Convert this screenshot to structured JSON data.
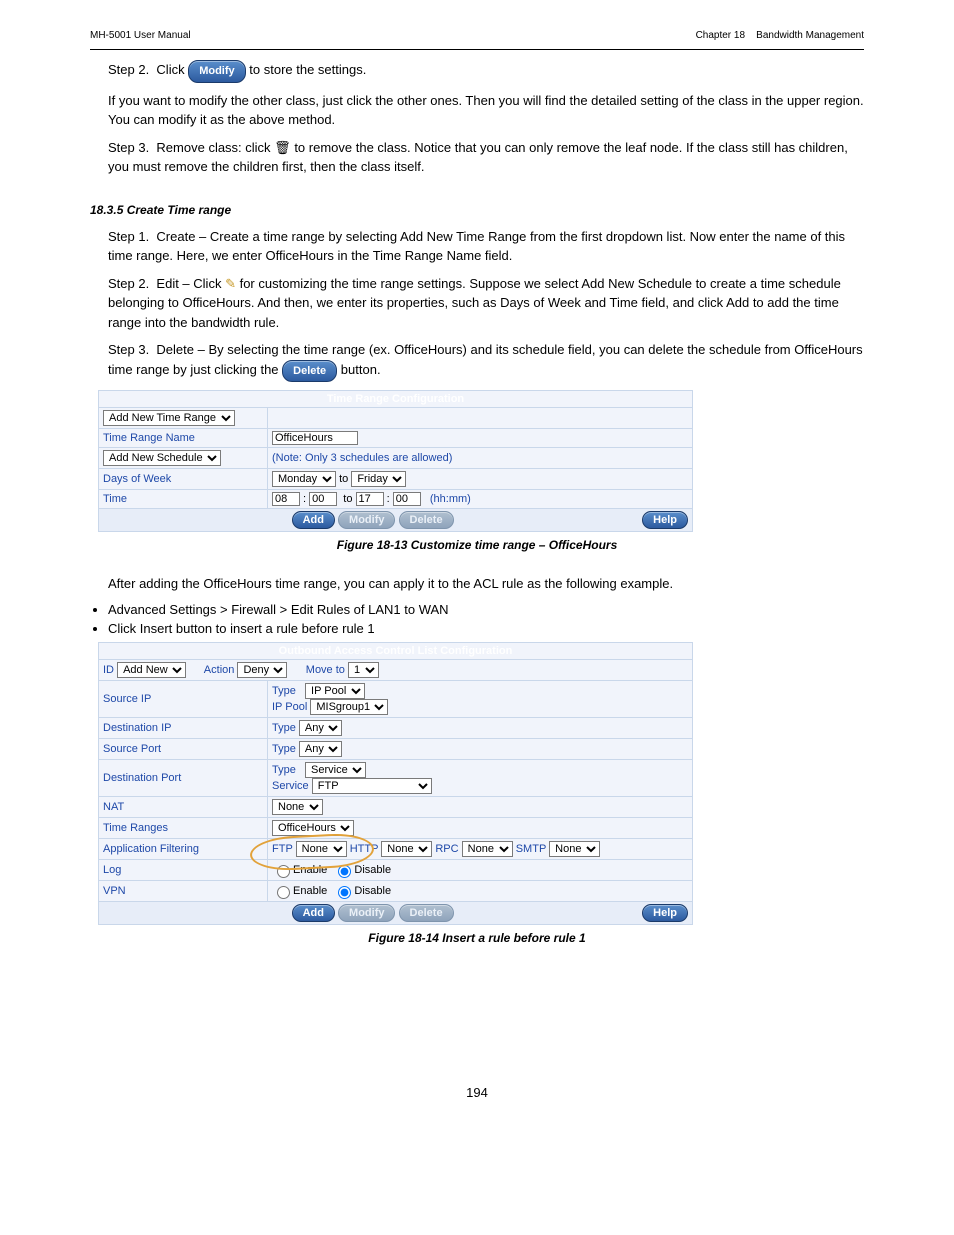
{
  "header": {
    "product": "MH-5001 User Manual",
    "chapter": "Chapter 18    Bandwidth Management"
  },
  "intro": {
    "step2_a": "Step 2.  Click ",
    "modify": "Modify",
    "step2_b": " to store the settings.",
    "after": "If you want to modify the other class, just click the other ones. Then you will find the detailed setting of the class in the upper region. You can modify it as the above method.",
    "step3_a": "Step 3.  Remove class: click ",
    "trash_char": "🗑",
    "step3_b": " to remove the class. Notice that you can only remove the leaf node. If the class still has children, you must remove the children first, then the class itself."
  },
  "ex_title": "18.3.5 Create Time range",
  "ex": {
    "s1_a": "Step 1.  Create – Create a time range by selecting Add New Time Range from the first dropdown list. Now enter the name of this time range. Here, we enter OfficeHours in the Time Range Name field.",
    "s2_a": "Step 2.  Edit – Click ",
    "pencil_char": "✎",
    "s2_b": " for customizing the time range settings. Suppose we select Add New Schedule to create a time schedule belonging to OfficeHours. And then, we enter its properties, such as Days of Week and Time field, and click Add to add the time range into the bandwidth rule.",
    "s3_a": "Step 3.  Delete – By selecting the time range (ex. OfficeHours) and its schedule field, you can delete the schedule from OfficeHours time range by just clicking the ",
    "delete": "Delete",
    "s3_b": " button."
  },
  "tbl1": {
    "title": "Time Range Configuration",
    "r1_sel": "Add New Time Range",
    "r2_label": "Time Range Name",
    "r2_val": "OfficeHours",
    "r3_sel": "Add New Schedule",
    "r3_note": "(Note: Only 3 schedules are allowed)",
    "r4_label": "Days of Week",
    "mon": "Monday",
    "to": "to",
    "fri": "Friday",
    "r5_label": "Time",
    "h1": "08",
    "m1": "00",
    "h2": "17",
    "m2": "00",
    "hhmm": "(hh:mm)",
    "add": "Add",
    "modify": "Modify",
    "delete": "Delete",
    "help": "Help"
  },
  "cap1": "Figure 18-13 Customize time range – OfficeHours",
  "add_time": "After adding the OfficeHours time range, you can apply it to the ACL rule as the following example.",
  "li1": "Advanced Settings > Firewall > Edit Rules of LAN1 to WAN",
  "li2": "Click Insert button to insert a rule before rule 1",
  "tbl2": {
    "title": "Outbound Access Control List Configuration",
    "id": "ID",
    "addnew": "Add New",
    "action": "Action",
    "deny": "Deny",
    "moveto": "Move to",
    "one": "1",
    "srcip": "Source IP",
    "type": "Type",
    "ippool": "IP Pool",
    "pool": "MISgroup1",
    "dstip": "Destination IP",
    "any": "Any",
    "sport": "Source Port",
    "dport": "Destination Port",
    "service": "Service",
    "ftp": "FTP",
    "nat": "NAT",
    "none": "None",
    "tr": "Time Ranges",
    "oh": "OfficeHours",
    "af": "Application Filtering",
    "ftpl": "FTP",
    "http": "HTTP",
    "rpc": "RPC",
    "smtp": "SMTP",
    "log": "Log",
    "enable": "Enable",
    "disable": "Disable",
    "vpn": "VPN",
    "add": "Add",
    "modify": "Modify",
    "delete": "Delete",
    "help": "Help"
  },
  "cap2": "Figure 18-14 Insert a rule before rule 1",
  "page": "194"
}
